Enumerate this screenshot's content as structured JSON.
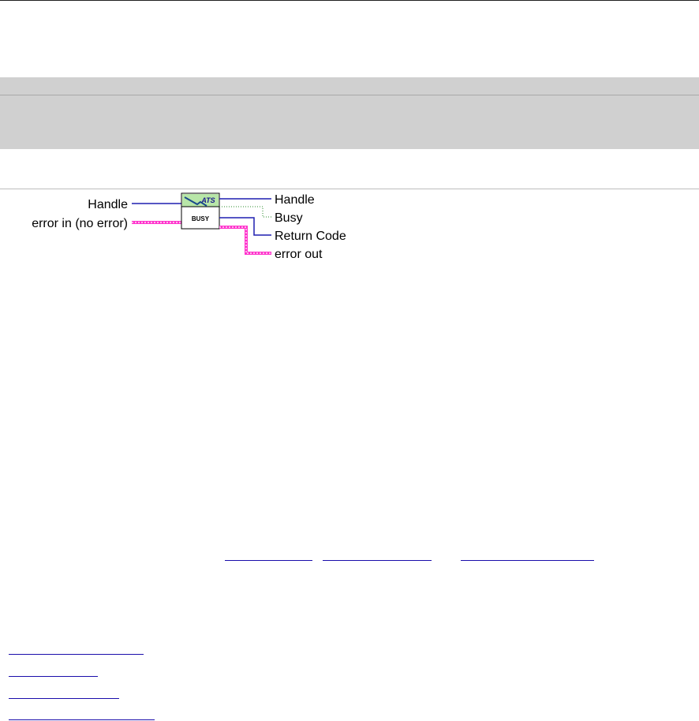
{
  "connector_pane": {
    "icon": {
      "banner_text": "ATS",
      "body_text": "BUSY"
    },
    "inputs": {
      "handle": "Handle",
      "error_in": "error in (no error)"
    },
    "outputs": {
      "handle": "Handle",
      "busy": "Busy",
      "return_code": "Return Code",
      "error_out": "error out"
    }
  },
  "colors": {
    "refnum_wire": "#1f1fb0",
    "error_wire": "#ff33cc",
    "boolean_wire": "#2a8a2a",
    "link": "#1a0dab",
    "section_band": "#d0d0d0"
  }
}
